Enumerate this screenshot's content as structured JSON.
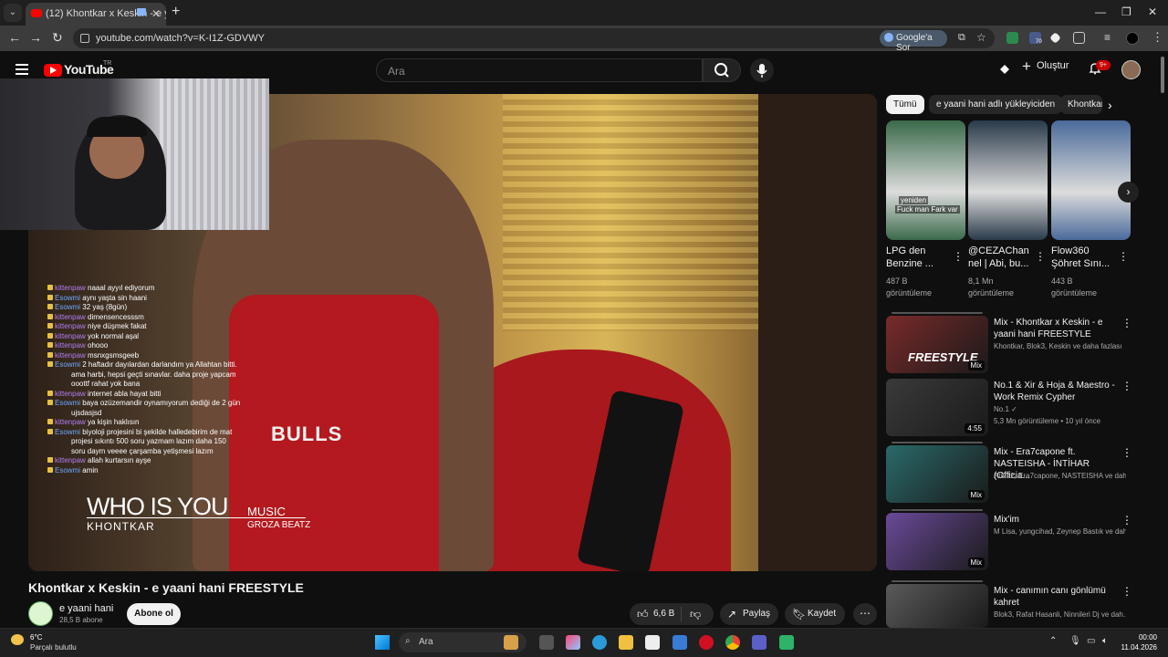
{
  "browser": {
    "tab_title": "(12) Khontkar x Keskin - e y...",
    "url": "youtube.com/watch?v=K-I1Z-GDVWY",
    "google_button": "Google'a Sor",
    "ext_badge": "70"
  },
  "header": {
    "logo_text": "YouTube",
    "logo_tr": "TR",
    "search_placeholder": "Ara",
    "create_label": "Oluştur",
    "notif_badge": "9+"
  },
  "video": {
    "title": "Khontkar x Keskin - e yaani hani FREESTYLE",
    "caption_big": "WHO IS YOU",
    "caption_sub": "KHONTKAR",
    "caption_music": "MUSIC",
    "caption_producer": "GROZA BEATZ",
    "jersey_text": "BULLS"
  },
  "chat": [
    {
      "user": "kittenpaw",
      "msg": "naaal ayyıl ediyorum",
      "cls": "u1"
    },
    {
      "user": "Esowmi",
      "msg": "aynı yaşta sin haani",
      "cls": "u2"
    },
    {
      "user": "Esowmi",
      "msg": "32 yaş (8gün)",
      "cls": "u2"
    },
    {
      "user": "kittenpaw",
      "msg": "dimensencesssm",
      "cls": "u1"
    },
    {
      "user": "kittenpaw",
      "msg": "niye düşmek fakat",
      "cls": "u1"
    },
    {
      "user": "kittenpaw",
      "msg": "yok normal aşal",
      "cls": "u1"
    },
    {
      "user": "kittenpaw",
      "msg": "ohooo",
      "cls": "u1"
    },
    {
      "user": "kittenpaw",
      "msg": "msnxgsmsgeeb",
      "cls": "u1"
    },
    {
      "user": "Esowmi",
      "msg": "2 haftadır dayılardan darlandım ya Allahtan bitti.",
      "cls": "u2"
    },
    {
      "user": "",
      "msg": "ama harbi, hepsi geçti sınavlar. daha proje yapcam",
      "cls": "msg"
    },
    {
      "user": "",
      "msg": "ooottf rahat yok bana",
      "cls": "msg"
    },
    {
      "user": "kittenpaw",
      "msg": "internet abla hayat bitti",
      "cls": "u1"
    },
    {
      "user": "Esowmi",
      "msg": "baya ozüzemandir oynamıyorum dediği de 2 gün",
      "cls": "u2"
    },
    {
      "user": "",
      "msg": "ujsdasjsd",
      "cls": "msg"
    },
    {
      "user": "kittenpaw",
      "msg": "ya kişin haklısın",
      "cls": "u1"
    },
    {
      "user": "Esowmi",
      "msg": "biyoloji projesini bi şekilde halledebirim de mat",
      "cls": "u2"
    },
    {
      "user": "",
      "msg": "projesi sıkıntı 500 soru yazmam lazım daha 150",
      "cls": "msg"
    },
    {
      "user": "",
      "msg": "soru daym veeee çarşamba yetişmesi lazım",
      "cls": "msg"
    },
    {
      "user": "kittenpaw",
      "msg": "allah kurtarsın ayşe",
      "cls": "u1"
    },
    {
      "user": "Esowmi",
      "msg": "amin",
      "cls": "u2"
    }
  ],
  "channel": {
    "name": "e yaani hani",
    "subs": "28,5 B abone",
    "subscribe_label": "Abone ol"
  },
  "actions": {
    "likes": "6,6 B",
    "share": "Paylaş",
    "save": "Kaydet"
  },
  "chips": [
    "Tümü",
    "e yaani hani adlı yükleyiciden",
    "Khontkar"
  ],
  "shorts": [
    {
      "title": "LPG den Benzine ...",
      "views": "487 B görüntüleme",
      "overlay1": "yeniden",
      "overlay2": "Fuck man Fark var",
      "color": "#3a6a4a"
    },
    {
      "title": "@CEZAChan nel | Abi, bu...",
      "views": "8,1 Mn görüntüleme",
      "color": "#2a3a4a"
    },
    {
      "title": "Flow360 Şöhret Sını...",
      "views": "443 B görüntüleme",
      "color": "#4a6a9a"
    }
  ],
  "recommendations": [
    {
      "title": "Mix - Khontkar x Keskin - e yaani hani FREESTYLE",
      "meta": "Khontkar, Blok3, Keskin ve daha fazlası",
      "tag": "Mix",
      "thumb_text": "FREESTYLE",
      "color": "#7a2a2a",
      "mix": true
    },
    {
      "title": "No.1 & Xir & Hoja & Maestro - Work Remix Cypher",
      "meta": "No.1 ✓",
      "meta2": "5,3 Mn görüntüleme • 10 yıl önce",
      "tag": "4:55",
      "color": "#3a3a3a",
      "mix": false
    },
    {
      "title": "Mix - Era7capone ft. NASTEISHA - İNTİHAR (Officia...",
      "meta": "Ati242, Era7capone, NASTEISHA ve dah...",
      "tag": "Mix",
      "color": "#2a6a6a",
      "mix": true
    },
    {
      "title": "Mix'im",
      "meta": "M Lisa, yungcihad, Zeynep Bastık ve dah...",
      "tag": "Mix",
      "color": "#6a4a9a",
      "mix": true
    },
    {
      "title": "Mix - canımın canı gönlümü kahret",
      "meta": "Blok3, Rafat Hasanli, Ninnileri Dj ve dah...",
      "tag": "Mix",
      "color": "#5a5a5a",
      "mix": true
    }
  ],
  "taskbar": {
    "temp": "6°C",
    "weather": "Parçalı bulutlu",
    "search": "Ara",
    "time": "00:00",
    "date": "11.04.2026"
  }
}
